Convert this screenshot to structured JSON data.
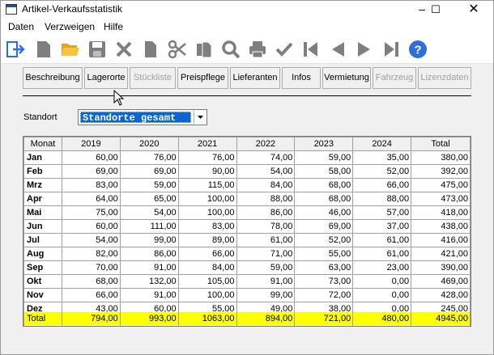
{
  "window": {
    "title": "Artikel-Verkaufsstatistik"
  },
  "menu": {
    "items": [
      "Daten",
      "Verzweigen",
      "Hilfe"
    ]
  },
  "tabs": [
    {
      "label": "Beschreibung",
      "enabled": true
    },
    {
      "label": "Lagerorte",
      "enabled": true
    },
    {
      "label": "Stückliste",
      "enabled": false
    },
    {
      "label": "Preispflege",
      "enabled": true
    },
    {
      "label": "Lieferanten",
      "enabled": true
    },
    {
      "label": "Infos",
      "enabled": true
    },
    {
      "label": "Vermietung",
      "enabled": true
    },
    {
      "label": "Fahrzeug",
      "enabled": false
    },
    {
      "label": "Lizenzdaten",
      "enabled": false
    }
  ],
  "filter": {
    "label": "Standort",
    "value": "Standorte gesamt"
  },
  "table": {
    "headers": [
      "Monat",
      "2019",
      "2020",
      "2021",
      "2022",
      "2023",
      "2024",
      "Total"
    ],
    "rows": [
      [
        "Jan",
        "60,00",
        "76,00",
        "76,00",
        "74,00",
        "59,00",
        "35,00",
        "380,00"
      ],
      [
        "Feb",
        "69,00",
        "69,00",
        "90,00",
        "54,00",
        "58,00",
        "52,00",
        "392,00"
      ],
      [
        "Mrz",
        "83,00",
        "59,00",
        "115,00",
        "84,00",
        "68,00",
        "66,00",
        "475,00"
      ],
      [
        "Apr",
        "64,00",
        "65,00",
        "100,00",
        "88,00",
        "68,00",
        "88,00",
        "473,00"
      ],
      [
        "Mai",
        "75,00",
        "54,00",
        "100,00",
        "86,00",
        "46,00",
        "57,00",
        "418,00"
      ],
      [
        "Jun",
        "60,00",
        "111,00",
        "83,00",
        "78,00",
        "69,00",
        "37,00",
        "438,00"
      ],
      [
        "Jul",
        "54,00",
        "99,00",
        "89,00",
        "61,00",
        "52,00",
        "61,00",
        "416,00"
      ],
      [
        "Aug",
        "82,00",
        "86,00",
        "66,00",
        "71,00",
        "55,00",
        "61,00",
        "421,00"
      ],
      [
        "Sep",
        "70,00",
        "91,00",
        "84,00",
        "59,00",
        "63,00",
        "23,00",
        "390,00"
      ],
      [
        "Okt",
        "68,00",
        "132,00",
        "105,00",
        "91,00",
        "73,00",
        "0,00",
        "469,00"
      ],
      [
        "Nov",
        "66,00",
        "91,00",
        "100,00",
        "99,00",
        "72,00",
        "0,00",
        "428,00"
      ],
      [
        "Dez",
        "43,00",
        "60,00",
        "55,00",
        "49,00",
        "38,00",
        "0,00",
        "245,00"
      ]
    ],
    "total": [
      "Total",
      "794,00",
      "993,00",
      "1063,00",
      "894,00",
      "721,00",
      "480,00",
      "4945,00"
    ]
  },
  "colors": {
    "selection": "#0a64d2",
    "total_row": "#ffff00",
    "toolbar_disabled": "#7f7f7f",
    "help": "#2d6fd6"
  },
  "toolbar_icons": [
    "exit-icon",
    "new-icon",
    "open-folder-icon",
    "save-icon",
    "delete-icon",
    "copy-icon",
    "cut-icon",
    "paste-icon",
    "search-icon",
    "print-icon",
    "confirm-icon",
    "first-record-icon",
    "previous-record-icon",
    "next-record-icon",
    "last-record-icon",
    "help-icon"
  ]
}
